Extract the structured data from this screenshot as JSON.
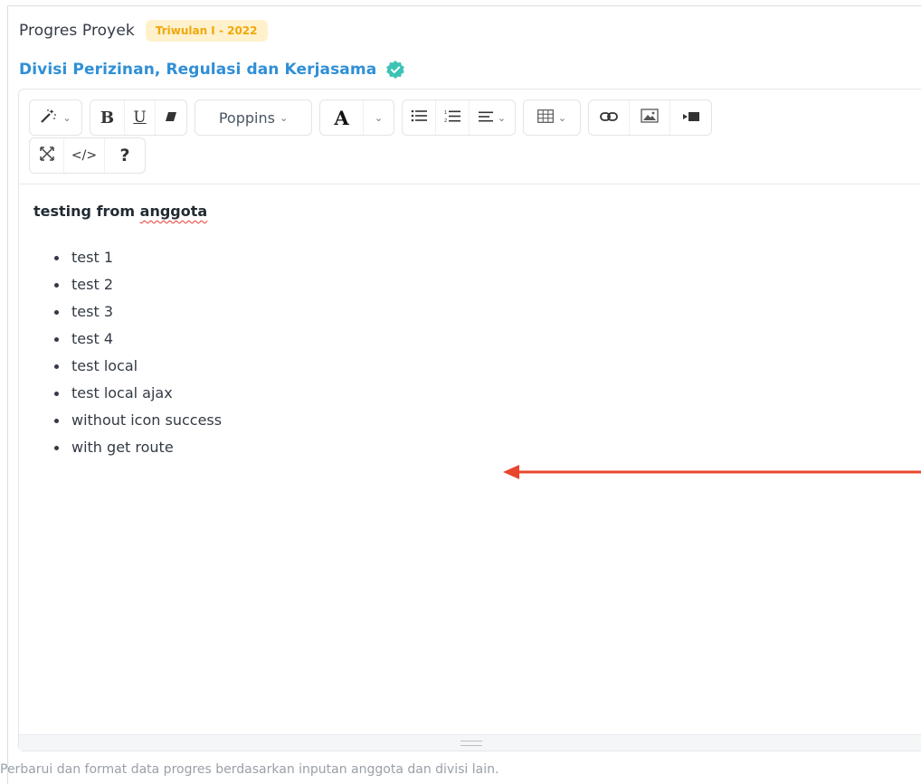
{
  "header": {
    "title": "Progres Proyek",
    "period_badge": "Triwulan I - 2022"
  },
  "division": {
    "name": "Divisi Perizinan, Regulasi dan Kerjasama",
    "verified_icon": "verified-check-icon",
    "verified_color": "#3cc3b5"
  },
  "toolbar": {
    "font_name": "Poppins",
    "bold_label": "B",
    "underline_label": "U",
    "font_color_label": "A",
    "code_view_label": "</>",
    "help_label": "?",
    "icons": [
      "magic-style-icon",
      "bold-icon",
      "underline-icon",
      "eraser-icon",
      "font-color-icon",
      "unordered-list-icon",
      "ordered-list-icon",
      "align-icon",
      "table-icon",
      "link-icon",
      "image-icon",
      "video-icon",
      "fullscreen-icon",
      "code-view-icon",
      "help-icon"
    ]
  },
  "content": {
    "heading_prefix": "testing from ",
    "heading_word": "anggota",
    "list_items": [
      "test 1",
      "test 2",
      "test 3",
      "test 4",
      "test local",
      "test local ajax",
      "without icon success",
      "with get route"
    ]
  },
  "helper_text": "Perbarui dan format data progres berdasarkan inputan anggota dan divisi lain.",
  "colors": {
    "accent": "#2f8fd6",
    "badge_bg": "#fff1cc",
    "badge_text": "#f0a70a",
    "annotation_arrow": "#e8462e"
  }
}
